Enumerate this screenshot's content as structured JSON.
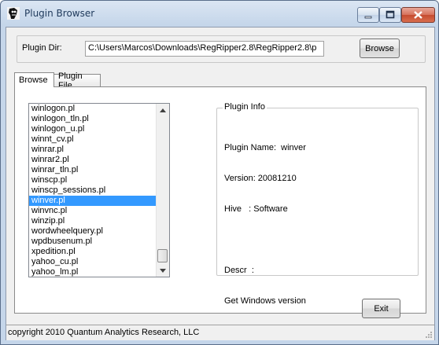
{
  "window": {
    "title": "Plugin Browser",
    "app_icon": "ripper-icon",
    "buttons": [
      "minimize-icon",
      "maximize-icon",
      "close-icon"
    ]
  },
  "plugin_dir": {
    "label": "Plugin Dir:",
    "value": "C:\\Users\\Marcos\\Downloads\\RegRipper2.8\\RegRipper2.8\\p",
    "browse_label": "Browse"
  },
  "tabs": [
    {
      "label": "Browse",
      "active": true
    },
    {
      "label": "Plugin File",
      "active": false
    }
  ],
  "plugin_list": {
    "items": [
      "winlogon.pl",
      "winlogon_tln.pl",
      "winlogon_u.pl",
      "winnt_cv.pl",
      "winrar.pl",
      "winrar2.pl",
      "winrar_tln.pl",
      "winscp.pl",
      "winscp_sessions.pl",
      "winver.pl",
      "winvnc.pl",
      "winzip.pl",
      "wordwheelquery.pl",
      "wpdbusenum.pl",
      "xpedition.pl",
      "yahoo_cu.pl",
      "yahoo_lm.pl"
    ],
    "selected": "winver.pl"
  },
  "plugin_info": {
    "legend": "Plugin Info",
    "name_line": "Plugin Name:  winver",
    "version_line": "Version: 20081210",
    "hive_line": "Hive   : Software",
    "descr_line": "Descr  :",
    "description": "Get Windows version"
  },
  "exit_label": "Exit",
  "status": "copyright 2010 Quantum Analytics Research, LLC",
  "colors": {
    "selection": "#3399ff",
    "titlebar": "#c5d6ea",
    "close_button": "#c54b2f"
  }
}
